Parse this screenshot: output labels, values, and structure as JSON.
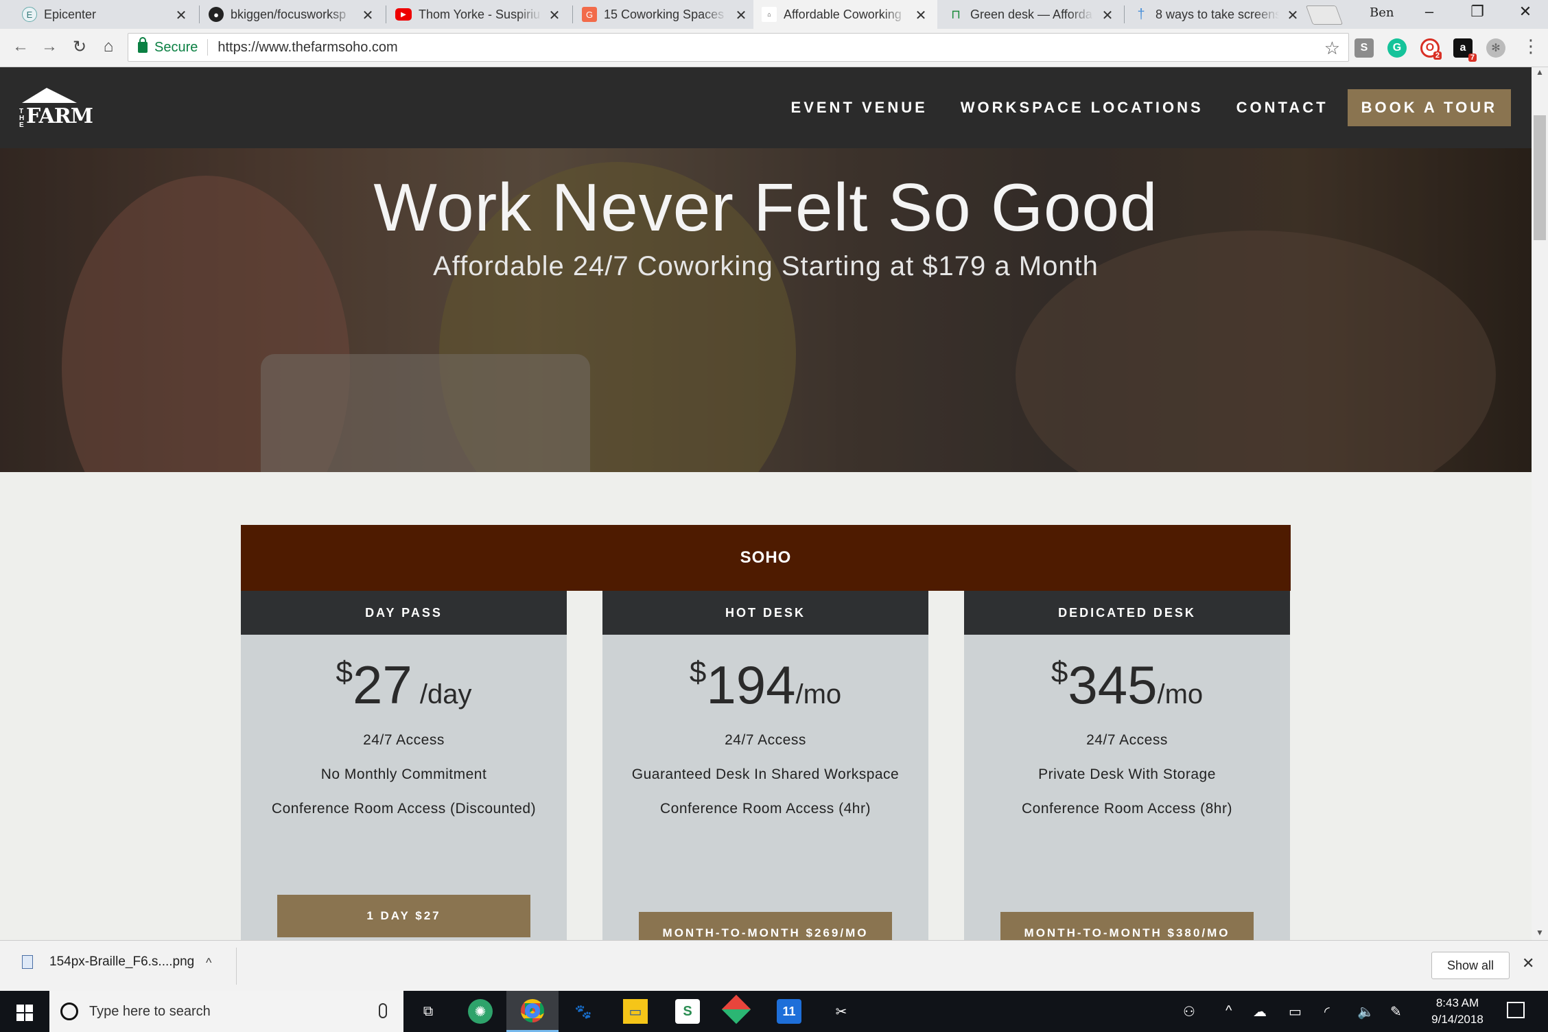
{
  "browser": {
    "tabs": [
      {
        "title": "Epicenter",
        "favicon": "E"
      },
      {
        "title": "bkiggen/focusworksp",
        "favicon": "github"
      },
      {
        "title": "Thom Yorke - Suspiriu",
        "favicon": "youtube"
      },
      {
        "title": "15 Coworking Spaces",
        "favicon": "G"
      },
      {
        "title": "Affordable Coworking",
        "favicon": "farm"
      },
      {
        "title": "Green desk — Afforda",
        "favicon": "greendesk"
      },
      {
        "title": "8 ways to take screens",
        "favicon": "pin"
      }
    ],
    "profile_name": "Ben",
    "secure_label": "Secure",
    "url": "https://www.thefarmsoho.com",
    "extension_badges": {
      "ext3": "2",
      "ext4": "7"
    }
  },
  "site": {
    "logo_the": "THE",
    "logo_farm": "FARM",
    "nav": {
      "event_venue": "EVENT VENUE",
      "workspace_locations": "WORKSPACE LOCATIONS",
      "contact": "CONTACT",
      "book_tour": "BOOK A TOUR"
    },
    "hero": {
      "title": "Work Never Felt So Good",
      "subtitle": "Affordable 24/7 Coworking Starting at $179 a Month"
    },
    "pricing": {
      "location": "SOHO",
      "plans": [
        {
          "name": "DAY PASS",
          "currency": "$",
          "amount": "27",
          "period": " /day",
          "features": [
            "24/7 Access",
            "No Monthly Commitment",
            "Conference Room Access (Discounted)"
          ],
          "cta": "1 DAY $27"
        },
        {
          "name": "HOT DESK",
          "currency": "$",
          "amount": "194",
          "period": "/mo",
          "features": [
            "24/7 Access",
            "Guaranteed Desk In Shared Workspace",
            "Conference Room Access (4hr)"
          ],
          "cta": "MONTH-TO-MONTH $269/MO"
        },
        {
          "name": "DEDICATED DESK",
          "currency": "$",
          "amount": "345",
          "period": "/mo",
          "features": [
            "24/7 Access",
            "Private Desk With Storage",
            "Conference Room Access (8hr)"
          ],
          "cta": "MONTH-TO-MONTH $380/MO"
        }
      ]
    }
  },
  "downloads": {
    "file": "154px-Braille_F6.s....png",
    "show_all": "Show all"
  },
  "taskbar": {
    "search_placeholder": "Type here to search",
    "time": "8:43 AM",
    "date": "9/14/2018",
    "calendar_day": "11"
  },
  "colors": {
    "nav_bg": "#2b2b2b",
    "accent_gold": "#8a7450",
    "location_header": "#4e1b00",
    "plan_header": "#2e3032",
    "plan_body": "#cdd2d4",
    "page_bg": "#eeefec"
  }
}
